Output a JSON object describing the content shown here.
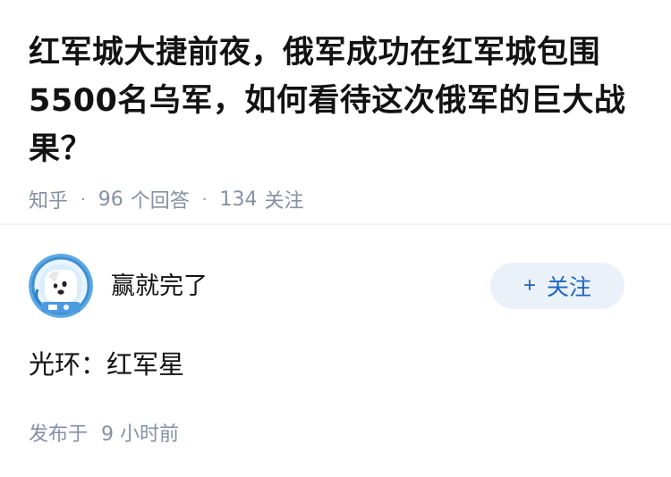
{
  "question": {
    "title": "红军城大捷前夜，俄军成功在红军城包围5500名乌军，如何看待这次俄军的巨大战果？",
    "source": "知乎",
    "answer_count": "96",
    "answer_label": "个回答",
    "follow_count": "134",
    "follow_label": "关注"
  },
  "answer": {
    "author_name": "赢就完了",
    "avatar_icon": "dog-astronaut-avatar",
    "follow_button": {
      "plus": "+",
      "label": "关注"
    },
    "content": "光环：红军星",
    "time_label": "发布于",
    "time_value": "9 小时前"
  },
  "colors": {
    "text_primary": "#121212",
    "text_secondary": "#8590a6",
    "accent": "#1a66c4",
    "follow_bg": "#ebf1f9",
    "divider": "#f0f2f7"
  }
}
